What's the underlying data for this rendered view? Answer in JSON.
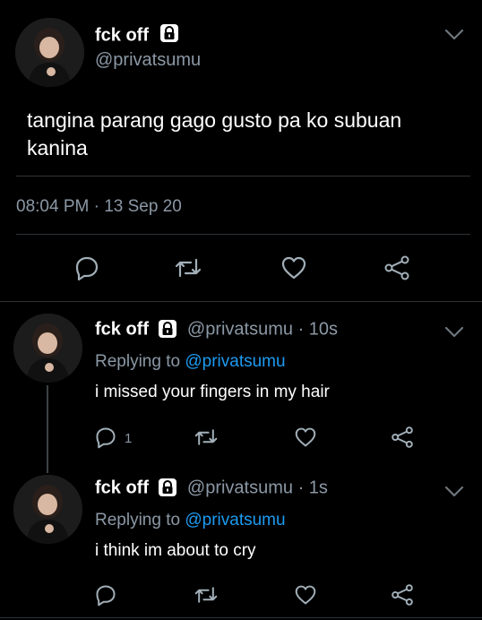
{
  "main_tweet": {
    "display_name": "fck off",
    "handle": "@privatsumu",
    "text": "tangina parang gago gusto pa ko subuan kanina",
    "timestamp": "08:04 PM · 13 Sep 20",
    "icons": [
      "reply-icon",
      "retweet-icon",
      "like-icon",
      "share-icon",
      "chevron-down-icon",
      "lock-icon"
    ]
  },
  "replies": [
    {
      "display_name": "fck off",
      "handle_time": "@privatsumu · 10s",
      "replying_prefix": "Replying to",
      "replying_to": "@privatsumu",
      "text": "i missed your fingers in my hair",
      "reply_count": "1"
    },
    {
      "display_name": "fck off",
      "handle_time": "@privatsumu · 1s",
      "replying_prefix": "Replying to",
      "replying_to": "@privatsumu",
      "text": "i think im about to cry",
      "reply_count": ""
    }
  ],
  "colors": {
    "background": "#000000",
    "text": "#ffffff",
    "muted": "#8b98a5",
    "link": "#1d9bf0",
    "divider": "#2f3336"
  }
}
